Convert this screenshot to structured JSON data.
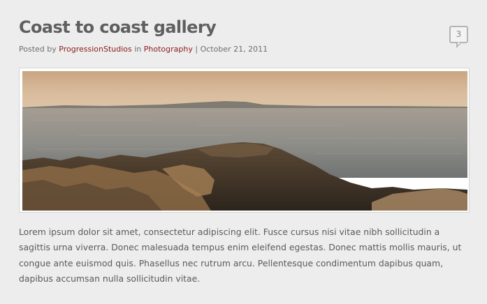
{
  "post": {
    "title": "Coast to coast gallery",
    "meta": {
      "posted_by_prefix": "Posted by",
      "author": "ProgressionStudios",
      "in_word": "in",
      "category": "Photography",
      "separator": "|",
      "date": "October 21, 2011"
    },
    "comment_count": "3",
    "image": {
      "icon": "coastline-photo"
    },
    "excerpt": "Lorem ipsum dolor sit amet, consectetur adipiscing elit. Fusce cursus nisi vitae nibh sollicitudin a sagittis urna viverra. Donec malesuada tempus enim eleifend egestas. Donec mattis mollis mauris, ut congue ante euismod quis. Phasellus nec rutrum arcu. Pellentesque condimentum dapibus quam, dapibus accumsan nulla sollicitudin vitae."
  },
  "colors": {
    "link": "#8b1b1b",
    "title": "#5f5f5f",
    "background": "#ededed"
  }
}
